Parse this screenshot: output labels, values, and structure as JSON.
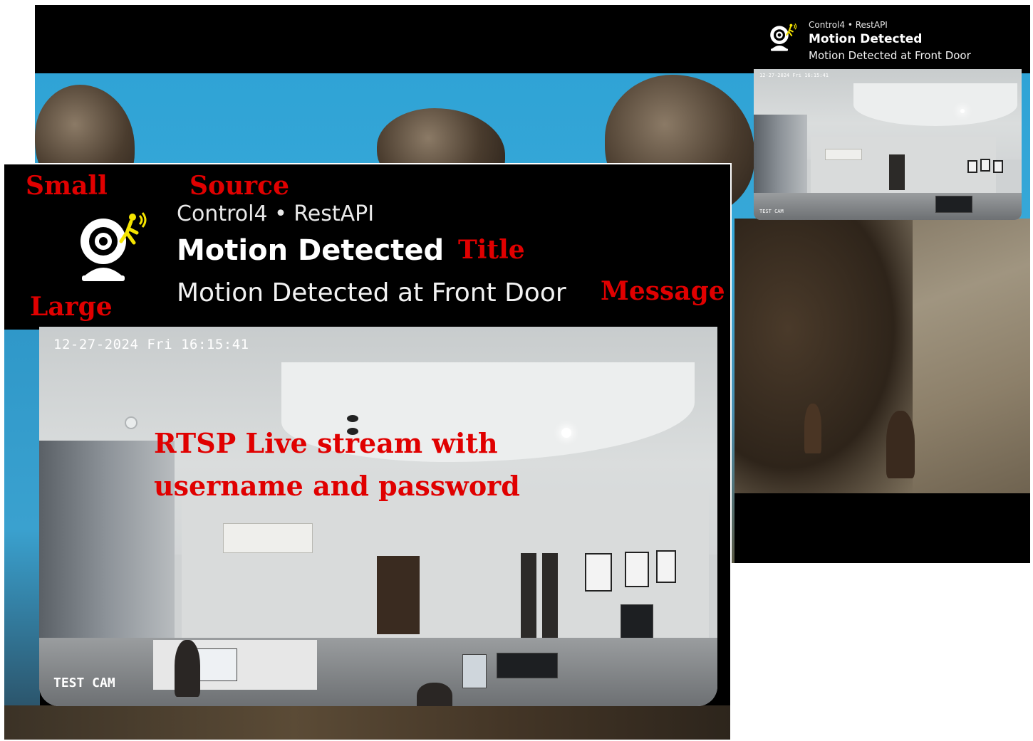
{
  "annotations": {
    "small": "Small",
    "source": "Source",
    "large": "Large",
    "title": "Title",
    "message": "Message",
    "stream_line1": "RTSP Live stream with",
    "stream_line2": "username and password"
  },
  "notification": {
    "source": "Control4 • RestAPI",
    "title": "Motion Detected",
    "message": "Motion Detected at Front Door",
    "icon": "motion-camera-icon"
  },
  "camera_feed": {
    "timestamp": "12-27-2024 Fri 16:15:41",
    "camera_label": "TEST CAM"
  },
  "colors": {
    "annotation_red": "#e00000",
    "sky_blue": "#2fa3d6",
    "panel_black": "#000000",
    "icon_yellow": "#f5e400"
  }
}
